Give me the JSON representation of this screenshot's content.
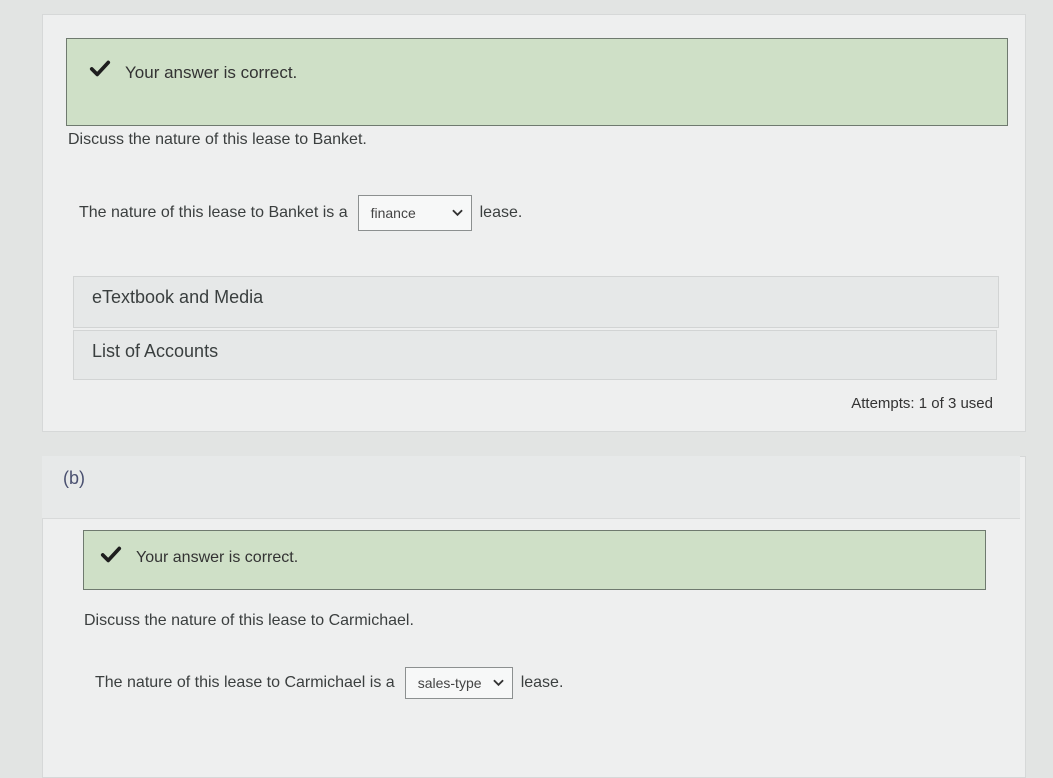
{
  "part_a": {
    "feedback": "Your answer is correct.",
    "prompt": "Discuss the nature of this lease to Banket.",
    "sentence_before": "The nature of this lease to Banket is a",
    "selected": "finance",
    "sentence_after": "lease.",
    "resources": [
      "eTextbook and Media",
      "List of Accounts"
    ],
    "attempts": "Attempts: 1 of 3 used"
  },
  "part_b": {
    "label": "(b)",
    "feedback": "Your answer is correct.",
    "prompt": "Discuss the nature of this lease to Carmichael.",
    "sentence_before": "The nature of this lease to Carmichael is a",
    "selected": "sales-type",
    "sentence_after": "lease."
  },
  "colors": {
    "success_bg": "#cfe0c7",
    "check": "#222222",
    "part_label": "#4a5070"
  }
}
